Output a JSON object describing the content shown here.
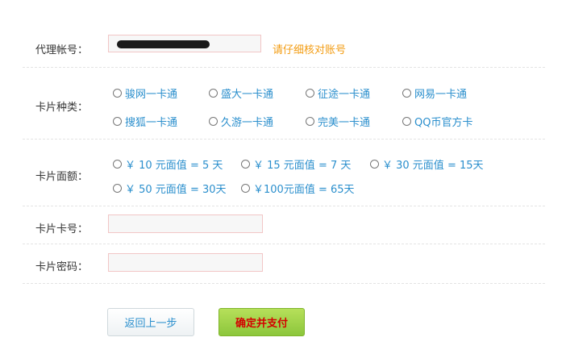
{
  "account": {
    "label": "代理帐号：",
    "hint": "请仔细核对账号"
  },
  "card_type": {
    "label": "卡片种类：",
    "options": [
      "骏网一卡通",
      "盛大一卡通",
      "征途一卡通",
      "网易一卡通",
      "搜狐一卡通",
      "久游一卡通",
      "完美一卡通",
      "QQ币官方卡"
    ]
  },
  "denomination": {
    "label": "卡片面额：",
    "options": [
      "￥ 10 元面值 = 5 天",
      "￥ 15 元面值 = 7 天",
      "￥ 30 元面值 = 15天",
      "￥ 50 元面值 = 30天",
      "￥100元面值 = 65天"
    ]
  },
  "card_number": {
    "label": "卡片卡号：",
    "value": ""
  },
  "card_password": {
    "label": "卡片密码：",
    "value": ""
  },
  "buttons": {
    "back": "返回上一步",
    "confirm": "确定并支付"
  },
  "colors": {
    "link_blue": "#2b8fcd",
    "hint_orange": "#f39c12",
    "confirm_text": "#d40000",
    "confirm_green": "#8cc63c"
  }
}
